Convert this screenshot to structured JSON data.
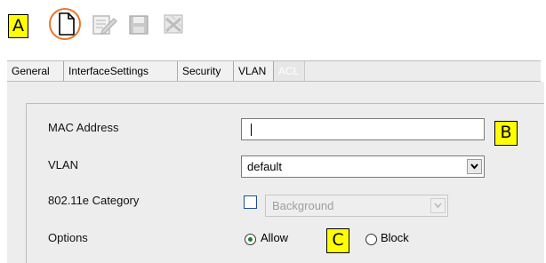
{
  "callouts": {
    "a": "A",
    "b": "B",
    "c": "C"
  },
  "toolbar": {
    "icons": [
      "new-document-icon",
      "edit-icon",
      "save-icon",
      "delete-icon"
    ],
    "highlight_color": "#e9762a"
  },
  "tabs": [
    "General",
    "InterfaceSettings",
    "Security",
    "VLAN",
    "ACL"
  ],
  "active_tab": "ACL",
  "form": {
    "mac_label": "MAC Address",
    "mac_value": "",
    "vlan_label": "VLAN",
    "vlan_value": "default",
    "category_label": "802.11e Category",
    "category_checked": false,
    "category_value": "Background",
    "options_label": "Options",
    "option_allow": "Allow",
    "option_block": "Block",
    "selected_option": "Allow"
  },
  "colors": {
    "callout_bg": "#ffff00",
    "panel_bg": "#ededed",
    "radio_selected": "#1d7f2a"
  }
}
